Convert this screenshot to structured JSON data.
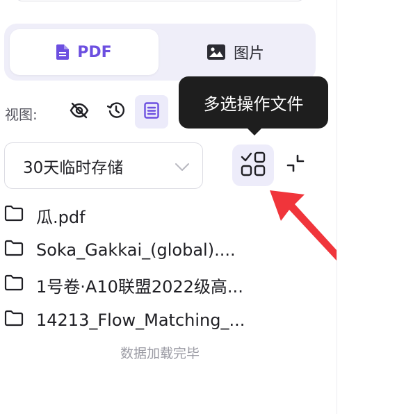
{
  "tabs": [
    {
      "label": "PDF",
      "icon": "document-icon",
      "active": true
    },
    {
      "label": "图片",
      "icon": "image-icon",
      "active": false
    }
  ],
  "view": {
    "label": "视图:",
    "buttons": [
      "hide-icon",
      "history-icon",
      "list-view-icon"
    ]
  },
  "tooltip": {
    "text": "多选操作文件"
  },
  "storage": {
    "selected": "30天临时存储"
  },
  "files": [
    {
      "name": "瓜.pdf"
    },
    {
      "name": "Soka_Gakkai_(global)...."
    },
    {
      "name": "1号卷·A10联盟2022级高..."
    },
    {
      "name": "14213_Flow_Matching_..."
    }
  ],
  "footer": {
    "text": "数据加载完毕"
  },
  "colors": {
    "accent": "#6c4fe0",
    "tab_bg": "#efeef9",
    "active_button_bg": "#edecfa",
    "tooltip_bg": "#1e1e1e",
    "annotation_arrow": "#f0353b"
  }
}
